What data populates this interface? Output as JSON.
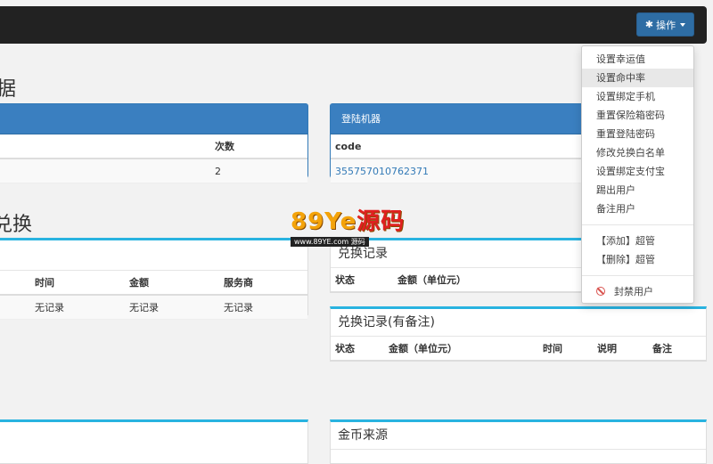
{
  "header": {
    "op_button_label": "操作"
  },
  "sections": {
    "data_title": "据",
    "exchange_title": "兑换"
  },
  "login_left": {
    "count_header": "次数",
    "count_value": "2"
  },
  "login_device": {
    "title": "登陆机器",
    "col_header": "code",
    "code_value": "355757010762371"
  },
  "exchange_left": {
    "columns": [
      "时间",
      "金额",
      "服务商"
    ],
    "row": [
      "无记录",
      "无记录",
      "无记录"
    ]
  },
  "exchange_record": {
    "title": "兑换记录",
    "columns": [
      "状态",
      "金额（单位元）"
    ]
  },
  "exchange_record_note": {
    "title": "兑换记录(有备注)",
    "columns": [
      "状态",
      "金额（单位元）",
      "时间",
      "说明",
      "备注"
    ]
  },
  "coin_source": {
    "title": "金币来源"
  },
  "dropdown": {
    "items": [
      "设置幸运值",
      "设置命中率",
      "设置绑定手机",
      "重置保险箱密码",
      "重置登陆密码",
      "修改兑换白名单",
      "设置绑定支付宝",
      "踢出用户",
      "备注用户"
    ],
    "admin_items": [
      "【添加】超管",
      "【删除】超管"
    ],
    "ban_label": "封禁用户"
  },
  "watermark": {
    "main": "89Ye",
    "main_src": "源码",
    "sub": "www.89YE.com",
    "sub2": "源码"
  }
}
